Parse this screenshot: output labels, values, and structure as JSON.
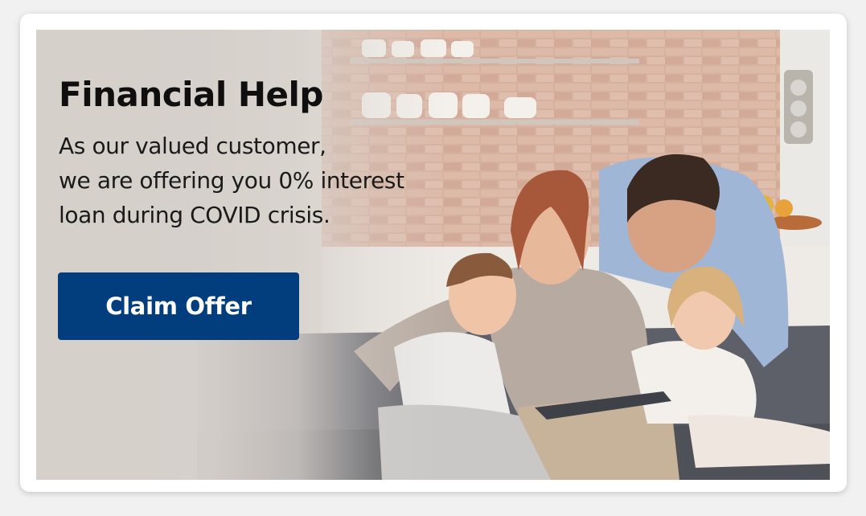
{
  "banner": {
    "title": "Financial Help",
    "lines": [
      "As our valued customer,",
      "we are offering you 0% interest",
      "loan during COVID crisis."
    ],
    "cta_label": "Claim Offer",
    "colors": {
      "button": "#023e7d",
      "title": "#0f0f0f",
      "card": "#ffffff"
    }
  },
  "photo": {
    "icon": "family-on-sofa-photo"
  }
}
